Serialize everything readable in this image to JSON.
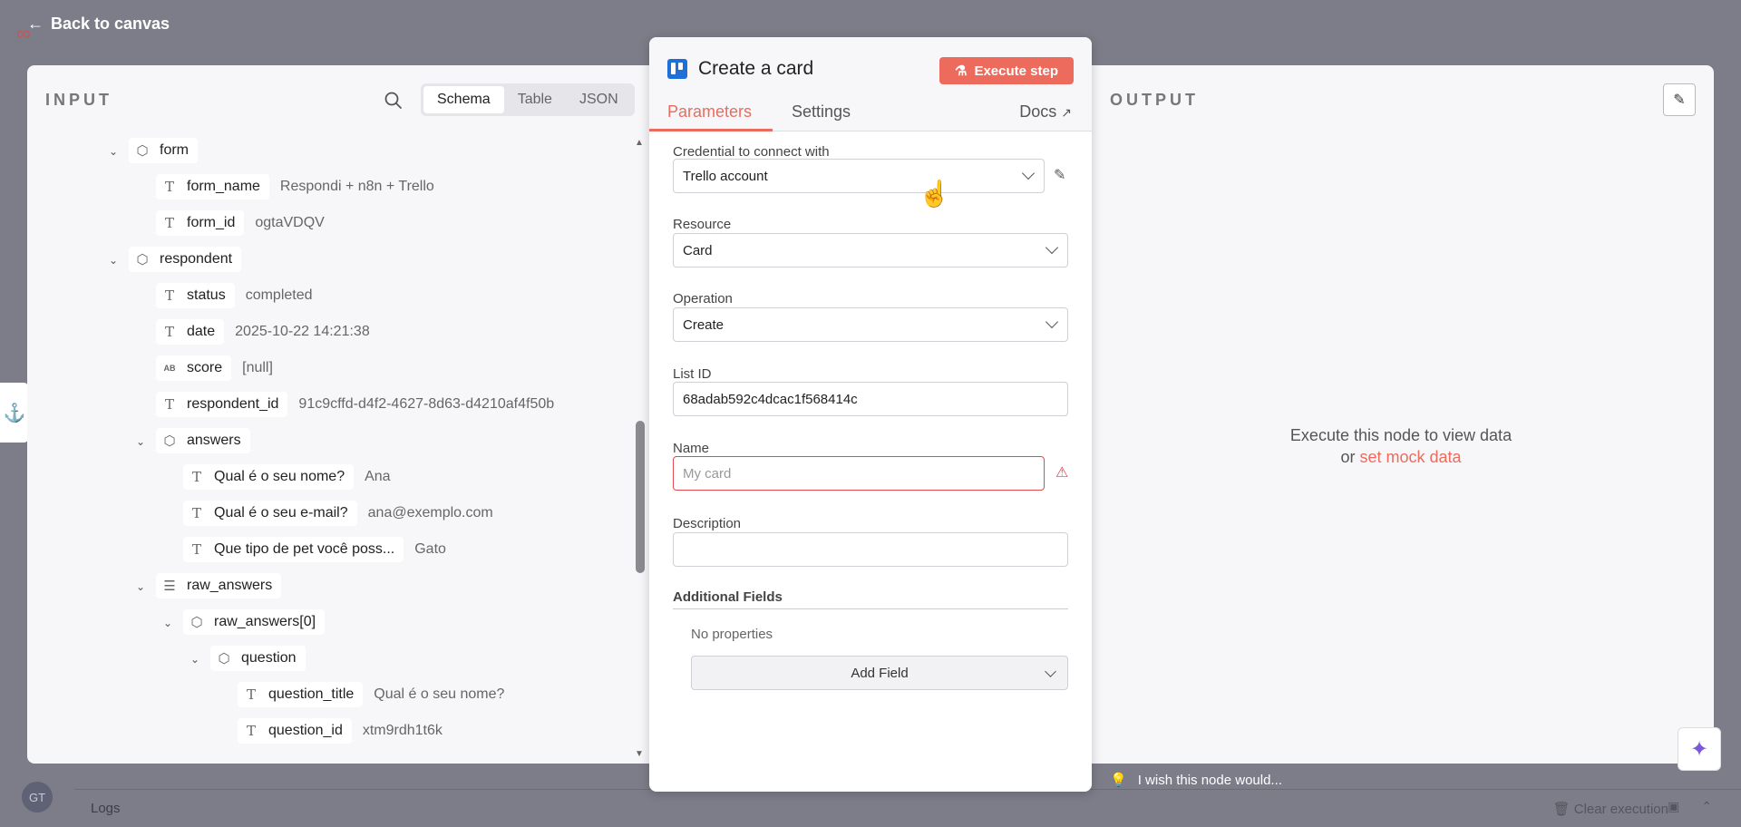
{
  "header": {
    "back_label": "Back to canvas"
  },
  "background": {
    "avatar": "GT",
    "logs": "Logs",
    "clear": "Clear execution"
  },
  "input": {
    "label": "INPUT",
    "tabs": [
      {
        "label": "Schema"
      },
      {
        "label": "Table"
      },
      {
        "label": "JSON"
      }
    ],
    "rows": [
      {
        "key": "form",
        "type": "object",
        "value": ""
      },
      {
        "key": "form_name",
        "type": "text",
        "value": "Respondi + n8n + Trello"
      },
      {
        "key": "form_id",
        "type": "text",
        "value": "ogtaVDQV"
      },
      {
        "key": "respondent",
        "type": "object",
        "value": ""
      },
      {
        "key": "status",
        "type": "text",
        "value": "completed"
      },
      {
        "key": "date",
        "type": "text",
        "value": "2025-10-22 14:21:38"
      },
      {
        "key": "score",
        "type": "null",
        "value": "[null]"
      },
      {
        "key": "respondent_id",
        "type": "text",
        "value": "91c9cffd-d4f2-4627-8d63-d4210af4f50b"
      },
      {
        "key": "answers",
        "type": "object",
        "value": ""
      },
      {
        "key": "Qual é o seu nome?",
        "type": "text",
        "value": "Ana"
      },
      {
        "key": "Qual é o seu e-mail?",
        "type": "text",
        "value": "ana@exemplo.com"
      },
      {
        "key": "Que tipo de pet você poss...",
        "type": "text",
        "value": "Gato"
      },
      {
        "key": "raw_answers",
        "type": "array",
        "value": ""
      },
      {
        "key": "raw_answers[0]",
        "type": "object",
        "value": ""
      },
      {
        "key": "question",
        "type": "object",
        "value": ""
      },
      {
        "key": "question_title",
        "type": "text",
        "value": "Qual é o seu nome?"
      },
      {
        "key": "question_id",
        "type": "text",
        "value": "xtm9rdh1t6k"
      }
    ]
  },
  "editor": {
    "title": "Create a card",
    "execute_label": "Execute step",
    "tabs": {
      "parameters": "Parameters",
      "settings": "Settings",
      "docs": "Docs"
    },
    "credential": {
      "label": "Credential to connect with",
      "value": "Trello account"
    },
    "resource": {
      "label": "Resource",
      "value": "Card"
    },
    "operation": {
      "label": "Operation",
      "value": "Create"
    },
    "list_id": {
      "label": "List ID",
      "value": "68adab592c4dcac1f568414c"
    },
    "name": {
      "label": "Name",
      "placeholder": "My card"
    },
    "description": {
      "label": "Description",
      "value": ""
    },
    "additional": {
      "label": "Additional Fields",
      "empty": "No properties",
      "add_label": "Add Field"
    }
  },
  "output": {
    "label": "OUTPUT",
    "message": "Execute this node to view data",
    "or": "or",
    "mock_link": "set mock data",
    "wish": "I wish this node would..."
  },
  "colors": {
    "accent": "#ec6b5d",
    "trello": "#1f6fd6",
    "error": "#e5484d"
  }
}
